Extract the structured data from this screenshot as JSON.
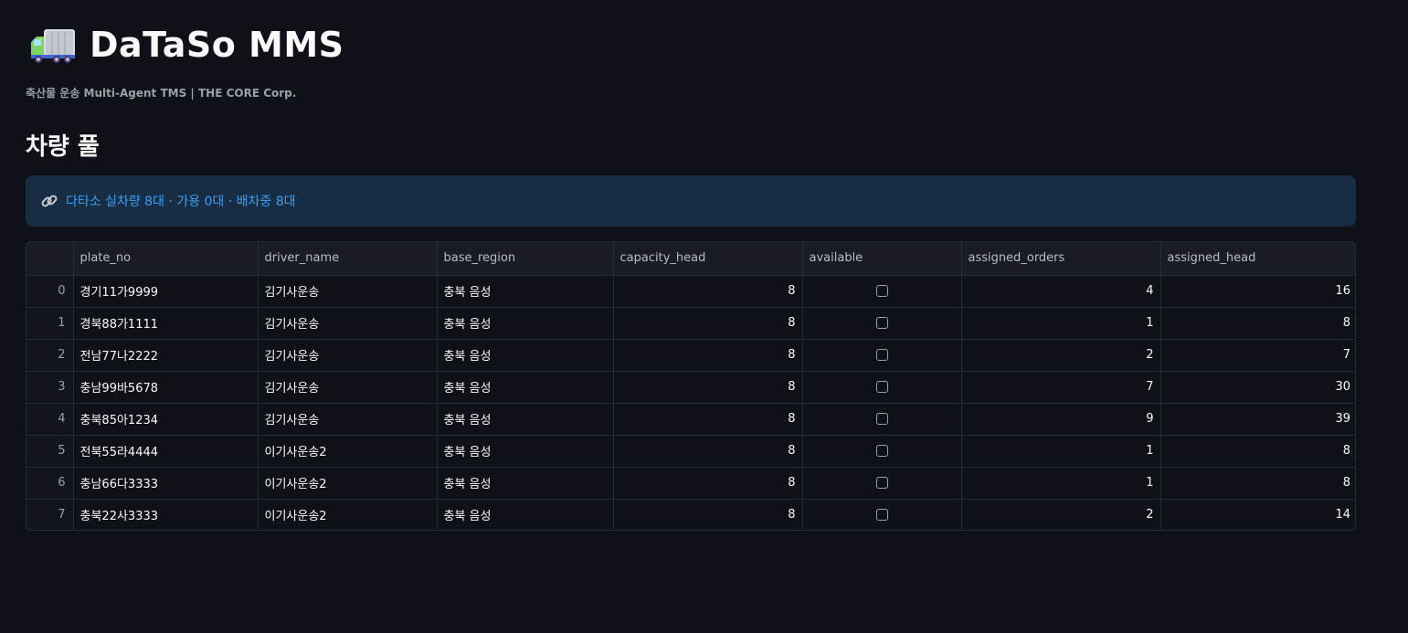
{
  "app": {
    "title": "DaTaSo MMS",
    "subtitle": "축산물 운송 Multi-Agent TMS | THE CORE Corp.",
    "icon": "truck-icon"
  },
  "section": {
    "title": "차량 풀"
  },
  "banner": {
    "icon": "link-icon",
    "text": "다타소 실차량 8대 · 가용 0대 · 배차중 8대"
  },
  "table": {
    "columns": [
      "plate_no",
      "driver_name",
      "base_region",
      "capacity_head",
      "available",
      "assigned_orders",
      "assigned_head"
    ],
    "rows": [
      {
        "index": "0",
        "plate_no": "경기11가9999",
        "driver_name": "김기사운송",
        "base_region": "충북 음성",
        "capacity_head": "8",
        "available": false,
        "assigned_orders": "4",
        "assigned_head": "16"
      },
      {
        "index": "1",
        "plate_no": "경북88가1111",
        "driver_name": "김기사운송",
        "base_region": "충북 음성",
        "capacity_head": "8",
        "available": false,
        "assigned_orders": "1",
        "assigned_head": "8"
      },
      {
        "index": "2",
        "plate_no": "전남77나2222",
        "driver_name": "김기사운송",
        "base_region": "충북 음성",
        "capacity_head": "8",
        "available": false,
        "assigned_orders": "2",
        "assigned_head": "7"
      },
      {
        "index": "3",
        "plate_no": "충남99바5678",
        "driver_name": "김기사운송",
        "base_region": "충북 음성",
        "capacity_head": "8",
        "available": false,
        "assigned_orders": "7",
        "assigned_head": "30"
      },
      {
        "index": "4",
        "plate_no": "충북85아1234",
        "driver_name": "김기사운송",
        "base_region": "충북 음성",
        "capacity_head": "8",
        "available": false,
        "assigned_orders": "9",
        "assigned_head": "39"
      },
      {
        "index": "5",
        "plate_no": "전북55라4444",
        "driver_name": "이기사운송2",
        "base_region": "충북 음성",
        "capacity_head": "8",
        "available": false,
        "assigned_orders": "1",
        "assigned_head": "8"
      },
      {
        "index": "6",
        "plate_no": "충남66다3333",
        "driver_name": "이기사운송2",
        "base_region": "충북 음성",
        "capacity_head": "8",
        "available": false,
        "assigned_orders": "1",
        "assigned_head": "8"
      },
      {
        "index": "7",
        "plate_no": "충북22사3333",
        "driver_name": "이기사운송2",
        "base_region": "충북 음성",
        "capacity_head": "8",
        "available": false,
        "assigned_orders": "2",
        "assigned_head": "14"
      }
    ]
  },
  "colors": {
    "background": "#0e1117",
    "banner_bg": "#172d43",
    "banner_text": "#3d9df3"
  }
}
